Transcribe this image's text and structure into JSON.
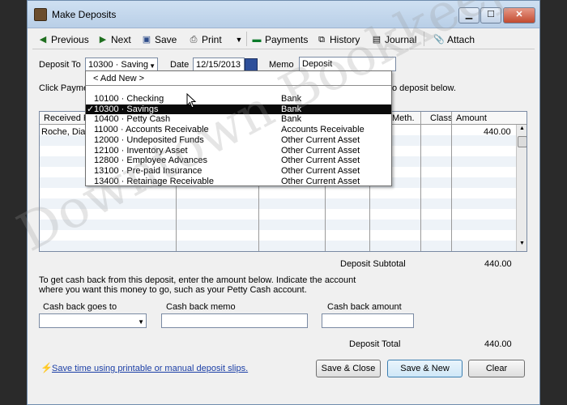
{
  "window": {
    "title": "Make Deposits"
  },
  "toolbar": {
    "previous": "Previous",
    "next": "Next",
    "save": "Save",
    "print": "Print",
    "payments": "Payments",
    "history": "History",
    "journal": "Journal",
    "attach": "Attach"
  },
  "form": {
    "deposit_to_label": "Deposit To",
    "deposit_to_value": "10300 · Saving",
    "date_label": "Date",
    "date_value": "12/15/2013",
    "memo_label": "Memo",
    "memo_value": "Deposit",
    "instruction": "Click Paymen",
    "instruction_tail": "o deposit below."
  },
  "account_dropdown": {
    "add_new": "< Add New >",
    "items": [
      {
        "check": "",
        "name": "10100 · Checking",
        "type": "Bank"
      },
      {
        "check": "✓",
        "name": "10300 · Savings",
        "type": "Bank",
        "selected": true
      },
      {
        "check": "",
        "name": "10400 · Petty Cash",
        "type": "Bank"
      },
      {
        "check": "",
        "name": "11000 · Accounts Receivable",
        "type": "Accounts Receivable"
      },
      {
        "check": "",
        "name": "12000 · Undeposited Funds",
        "type": "Other Current Asset"
      },
      {
        "check": "",
        "name": "12100 · Inventory Asset",
        "type": "Other Current Asset"
      },
      {
        "check": "",
        "name": "12800 · Employee Advances",
        "type": "Other Current Asset"
      },
      {
        "check": "",
        "name": "13100 · Pre-paid Insurance",
        "type": "Other Current Asset"
      },
      {
        "check": "",
        "name": "13400 · Retainage Receivable",
        "type": "Other Current Asset"
      }
    ]
  },
  "grid": {
    "columns": {
      "received_from": "Received F",
      "pmt_meth": "Meth.",
      "class": "Class",
      "amount": "Amount"
    },
    "rows": [
      {
        "received_from": "Roche, Dian",
        "amount": "440.00"
      }
    ]
  },
  "totals": {
    "subtotal_label": "Deposit Subtotal",
    "subtotal_value": "440.00",
    "total_label": "Deposit Total",
    "total_value": "440.00"
  },
  "cashback": {
    "instruction_1": "To get cash back from this deposit, enter the amount below.  Indicate the account",
    "instruction_2": "where you want this money to go, such as your Petty Cash account.",
    "goes_to_label": "Cash back goes to",
    "memo_label": "Cash back memo",
    "amount_label": "Cash back amount"
  },
  "footer": {
    "tip_link": "Save time using printable or manual deposit slips.",
    "save_close": "Save & Close",
    "save_new": "Save & New",
    "clear": "Clear"
  },
  "watermark": "Downtown Bookkeeping",
  "icons": {
    "previous": "left-arrow-icon",
    "next": "right-arrow-icon",
    "save": "floppy-disk-icon",
    "print": "printer-icon",
    "payments": "payments-icon",
    "history": "history-icon",
    "journal": "journal-icon",
    "attach": "paperclip-icon",
    "tip": "lightning-icon"
  }
}
